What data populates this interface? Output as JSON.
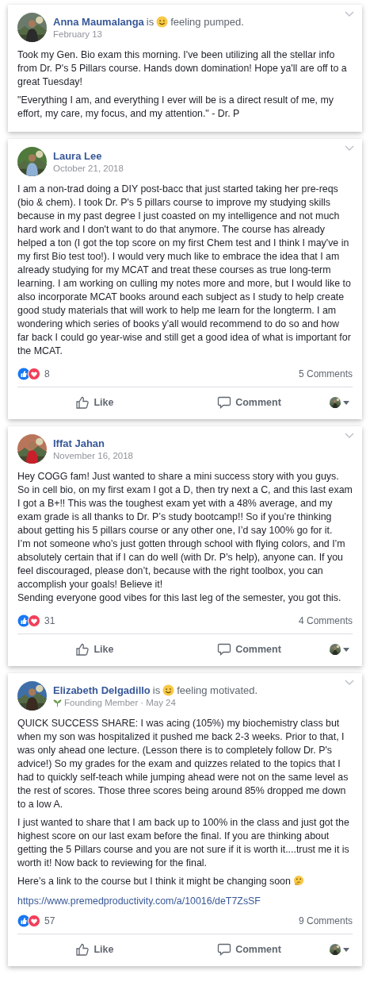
{
  "posts": [
    {
      "author": "Anna Maumalanga",
      "feeling": {
        "verb": "is",
        "text": "feeling pumped."
      },
      "date": "February 13",
      "paragraphs": [
        "Took my Gen. Bio exam this morning. I've been utilizing all the stellar info from Dr. P's 5 Pillars course. Hands down domination! Hope ya'll are off to a great Tuesday!",
        "\"Everything I am, and everything I ever will be is a direct result of me, my effort, my care, my focus, and my attention.\" - Dr. P"
      ]
    },
    {
      "author": "Laura Lee",
      "date": "October 21, 2018",
      "paragraphs": [
        "I am a non-trad doing a DIY post-bacc that just started taking her pre-reqs (bio & chem). I took Dr. P's 5 pillars course to improve my studying skills because in my past degree I just coasted on my intelligence and not much hard work and I don't want to do that anymore. The course has already helped a ton (I got the top score on my first Chem test and I think I may've in my first Bio test too!). I would very much like to embrace the idea that I am already studying for my MCAT and treat these courses as true long-term learning. I am working on culling my notes more and more, but I would like to also incorporate MCAT books around each subject as I study to help create good study materials that will work to help me learn for the longterm. I am wondering which series of books y'all would recommend to do so and how far back I could go year-wise and still get a good idea of what is important for the MCAT."
      ],
      "reactions": "8",
      "comments": "5 Comments",
      "actions": [
        "Like",
        "Comment"
      ]
    },
    {
      "author": "Iffat Jahan",
      "date": "November 16, 2018",
      "paragraphs": [
        "Hey COGG fam! Just wanted to share a mini success story with you guys. So in cell bio, on my first exam I got a D, then try next a C, and this last exam I got a B+!! This was the toughest exam yet with a 48% average, and my exam grade is all thanks to Dr. P’s study bootcamp!! So if you’re thinking about getting his 5 pillars course or any other one, I’d say 100% go for it.\nI’m not someone who’s just gotten through school with flying colors, and I’m absolutely certain that if I can do well (with Dr. P’s help), anyone can. If you feel discouraged, please don’t, because with the right toolbox, you can accomplish your goals! Believe it!\nSending everyone good vibes for this last leg of the semester, you got this."
      ],
      "reactions": "31",
      "comments": "4 Comments",
      "actions": [
        "Like",
        "Comment"
      ]
    },
    {
      "author": "Elizabeth Delgadillo",
      "feeling": {
        "verb": "is",
        "text": "feeling motivated."
      },
      "badge": "Founding Member",
      "separator": "·",
      "date": "May 24",
      "paragraphs": [
        "QUICK SUCCESS SHARE: I was acing (105%) my biochemistry class but when my son was hospitalized it pushed me back 2-3 weeks. Prior to that, I was only ahead one lecture. (Lesson there is to completely follow Dr. P's advice!) So my grades for the exam and quizzes related to the topics that I had to quickly self-teach while jumping ahead were not on the same level as the rest of scores. Those three scores being around 85% dropped me down to a low A.",
        "I just wanted to share that I am back up to 100% in the class and just got the highest score on our last exam before the final. If you are thinking about getting the 5 Pillars course and you are not sure if it is worth it....trust me it is worth it! Now back to reviewing for the final.",
        "Here’s a link to the course but I think it might be changing soon"
      ],
      "link": "https://www.premedproductivity.com/a/10016/deT7ZsSF",
      "reactions": "57",
      "comments": "9 Comments",
      "actions": [
        "Like",
        "Comment"
      ]
    }
  ]
}
